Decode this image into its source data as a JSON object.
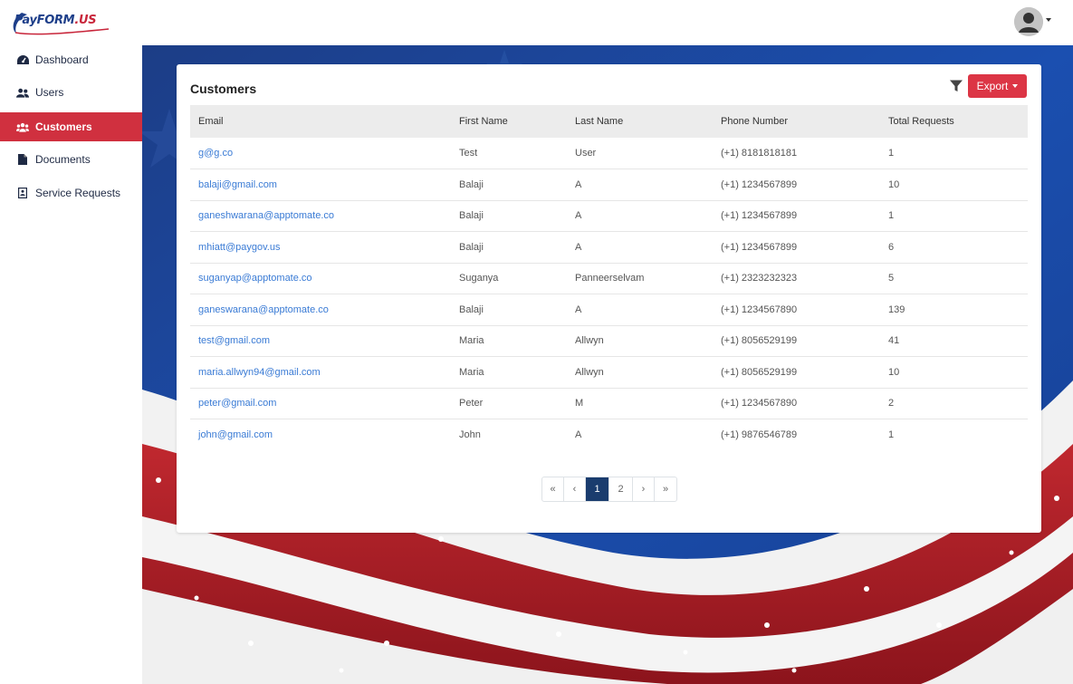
{
  "brand": {
    "name_main": "PayFORM",
    "name_suffix": ".US"
  },
  "sidebar": {
    "items": [
      {
        "label": "Dashboard",
        "icon": "dashboard-icon"
      },
      {
        "label": "Users",
        "icon": "users-icon"
      },
      {
        "label": "Customers",
        "icon": "customers-icon",
        "active": true
      },
      {
        "label": "Documents",
        "icon": "document-icon"
      },
      {
        "label": "Service Requests",
        "icon": "service-requests-icon"
      }
    ]
  },
  "card": {
    "title": "Customers",
    "export_label": "Export",
    "columns": [
      "Email",
      "First Name",
      "Last Name",
      "Phone Number",
      "Total Requests"
    ],
    "rows": [
      [
        "g@g.co",
        "Test",
        "User",
        "(+1) 8181818181",
        "1"
      ],
      [
        "balaji@gmail.com",
        "Balaji",
        "A",
        "(+1) 1234567899",
        "10"
      ],
      [
        "ganeshwarana@apptomate.co",
        "Balaji",
        "A",
        "(+1) 1234567899",
        "1"
      ],
      [
        "mhiatt@paygov.us",
        "Balaji",
        "A",
        "(+1) 1234567899",
        "6"
      ],
      [
        "suganyap@apptomate.co",
        "Suganya",
        "Panneerselvam",
        "(+1) 2323232323",
        "5"
      ],
      [
        "ganeswarana@apptomate.co",
        "Balaji",
        "A",
        "(+1) 1234567890",
        "139"
      ],
      [
        "test@gmail.com",
        "Maria",
        "Allwyn",
        "(+1) 8056529199",
        "41"
      ],
      [
        "maria.allwyn94@gmail.com",
        "Maria",
        "Allwyn",
        "(+1) 8056529199",
        "10"
      ],
      [
        "peter@gmail.com",
        "Peter",
        "M",
        "(+1) 1234567890",
        "2"
      ],
      [
        "john@gmail.com",
        "John",
        "A",
        "(+1) 9876546789",
        "1"
      ]
    ]
  },
  "pagination": {
    "first": "«",
    "prev": "‹",
    "pages": [
      "1",
      "2"
    ],
    "current": "1",
    "next": "›",
    "last": "»"
  },
  "colors": {
    "accent": "#dc3545",
    "active_sidebar": "#d0303f",
    "link": "#3a7bd5",
    "page_active": "#1a3c6e"
  }
}
